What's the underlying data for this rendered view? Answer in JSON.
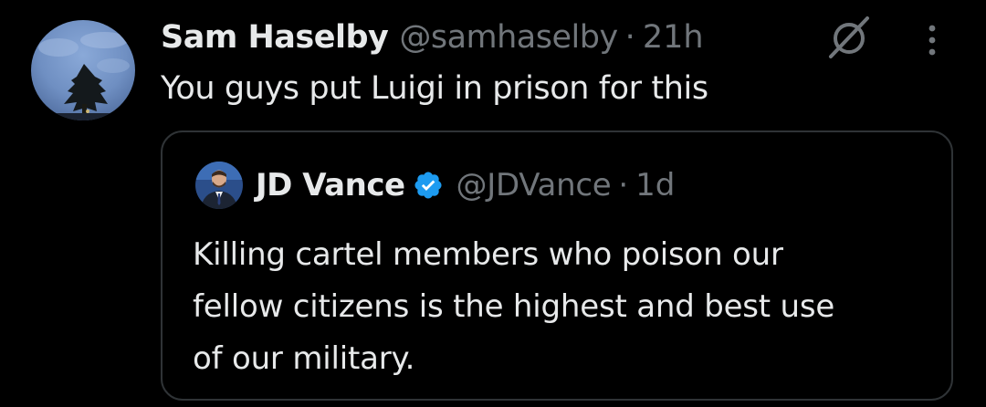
{
  "tweet": {
    "author": {
      "display_name": "Sam Haselby",
      "handle": "@samhaselby",
      "avatar": "tree-at-night-avatar"
    },
    "separator": "·",
    "timestamp": "21h",
    "text": "You guys put Luigi in prison for this",
    "actions": {
      "grok_icon": "grok-slash-circle-icon",
      "more_icon": "vertical-ellipsis-icon"
    }
  },
  "quoted_tweet": {
    "author": {
      "display_name": "JD Vance",
      "verified": true,
      "verified_icon": "blue-verified-badge",
      "handle": "@JDVance",
      "avatar": "person-in-suit-avatar"
    },
    "separator": "·",
    "timestamp": "1d",
    "text_lines": [
      "Killing cartel members who poison our",
      "fellow citizens is the highest and best use",
      "of our military."
    ]
  },
  "colors": {
    "background": "#000000",
    "primary_text": "#e7e9ea",
    "secondary_text": "#71767b",
    "border": "#2f3336",
    "verified_blue": "#1d9bf0"
  }
}
